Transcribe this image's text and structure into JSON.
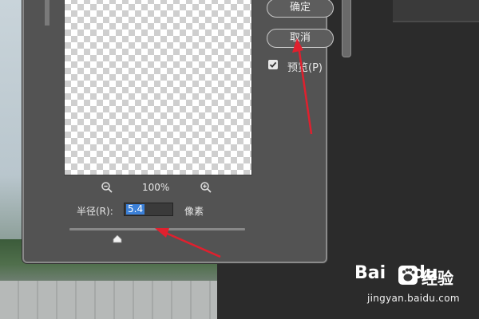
{
  "dialog": {
    "zoom_level": "100%",
    "radius_label": "半径(R):",
    "radius_value": "5.4",
    "radius_unit": "像素",
    "ok_label": "确定",
    "cancel_label": "取消",
    "preview_label": "预览(P)",
    "preview_checked": true
  },
  "watermark": {
    "brand_prefix": "Bai",
    "brand_suffix": "du",
    "brand_cn": "经验",
    "url": "jingyan.baidu.com"
  },
  "colors": {
    "dialog_bg": "#535353",
    "accent_selection": "#3b80d8",
    "annotation_arrow": "#e0202e"
  },
  "icons": [
    "zoom-out-icon",
    "zoom-in-icon",
    "check-icon",
    "slider-thumb-icon",
    "paw-icon"
  ]
}
